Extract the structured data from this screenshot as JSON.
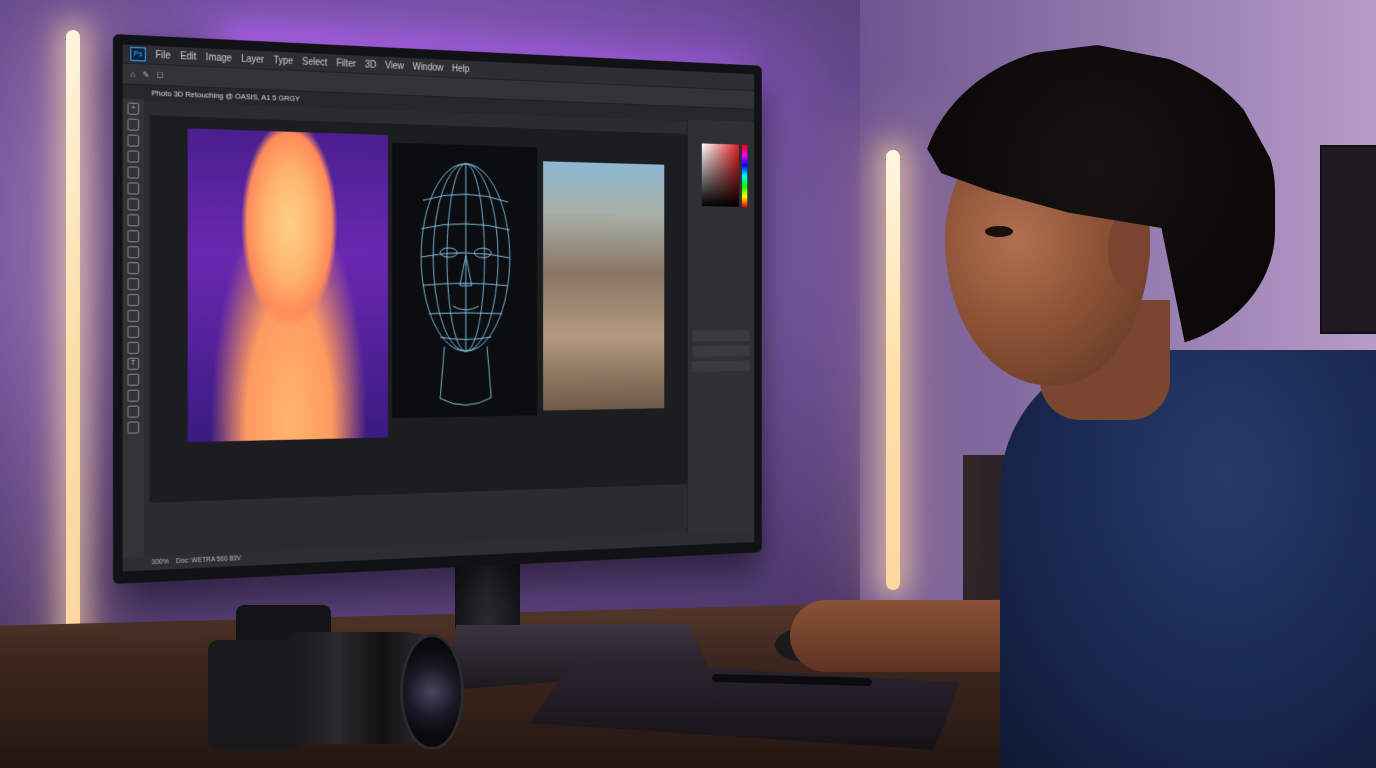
{
  "photoshop": {
    "logo": "Ps",
    "menu": [
      "File",
      "Edit",
      "Image",
      "Layer",
      "Type",
      "Select",
      "Filter",
      "3D",
      "View",
      "Window",
      "Help"
    ],
    "document_tab": "Photo 3D Retouching @ OASIS, A1 5 GRGY",
    "status_bar_left": "300%",
    "status_bar_doc": "Doc: WETRA 560 80V"
  }
}
